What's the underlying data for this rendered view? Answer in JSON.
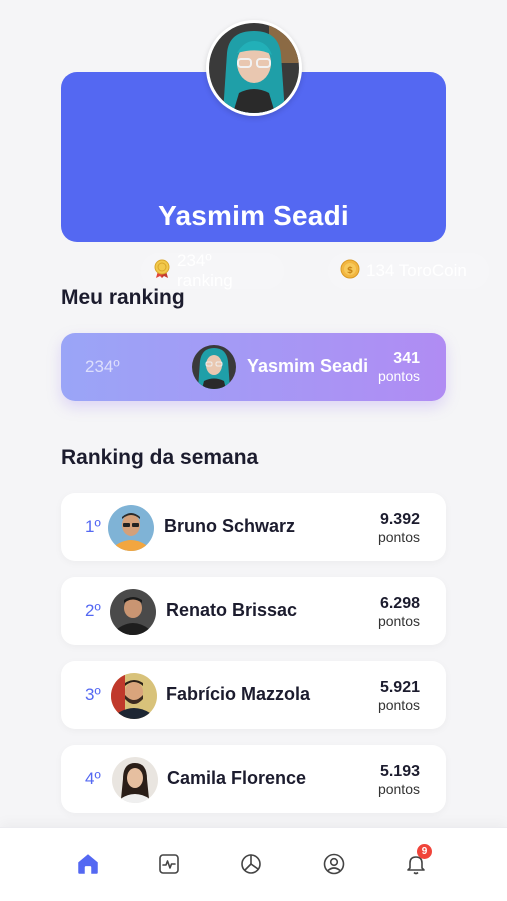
{
  "profile": {
    "name": "Yasmim Seadi",
    "ranking": "234º ranking",
    "coins": "134 ToroCoin"
  },
  "my_ranking": {
    "title": "Meu ranking",
    "position": "234º",
    "name": "Yasmim Seadi",
    "points": "341",
    "points_label": "pontos"
  },
  "weekly": {
    "title": "Ranking da semana",
    "rows": [
      {
        "position": "1º",
        "name": "Bruno Schwarz",
        "points": "9.392",
        "points_label": "pontos"
      },
      {
        "position": "2º",
        "name": "Renato Brissac",
        "points": "6.298",
        "points_label": "pontos"
      },
      {
        "position": "3º",
        "name": "Fabrício Mazzola",
        "points": "5.921",
        "points_label": "pontos"
      },
      {
        "position": "4º",
        "name": "Camila Florence",
        "points": "5.193",
        "points_label": "pontos"
      }
    ]
  },
  "nav": {
    "items": [
      "home-icon",
      "activity-icon",
      "chart-icon",
      "profile-icon",
      "bell-icon"
    ],
    "notification_count": "9"
  },
  "colors": {
    "accent": "#5468f2",
    "gradient_start": "#9aa5f7",
    "gradient_end": "#b08cf3",
    "badge": "#f0443a"
  }
}
